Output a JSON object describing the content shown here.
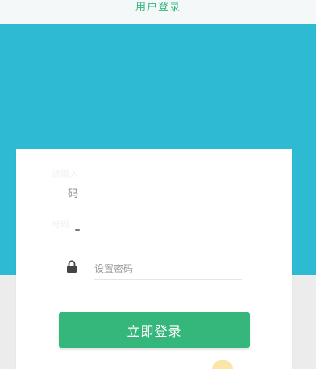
{
  "header": {
    "title": "用户登录"
  },
  "form": {
    "field1_label": "码",
    "field1_partial": "一",
    "password_placeholder": "设置密码",
    "submit_label": "立即登录",
    "faint_text_1": "请输入",
    "faint_text_2": "号码"
  },
  "icons": {
    "lock": "lock-icon"
  },
  "colors": {
    "hero": "#2fbad3",
    "accent": "#35b67a",
    "background": "#ececec"
  }
}
